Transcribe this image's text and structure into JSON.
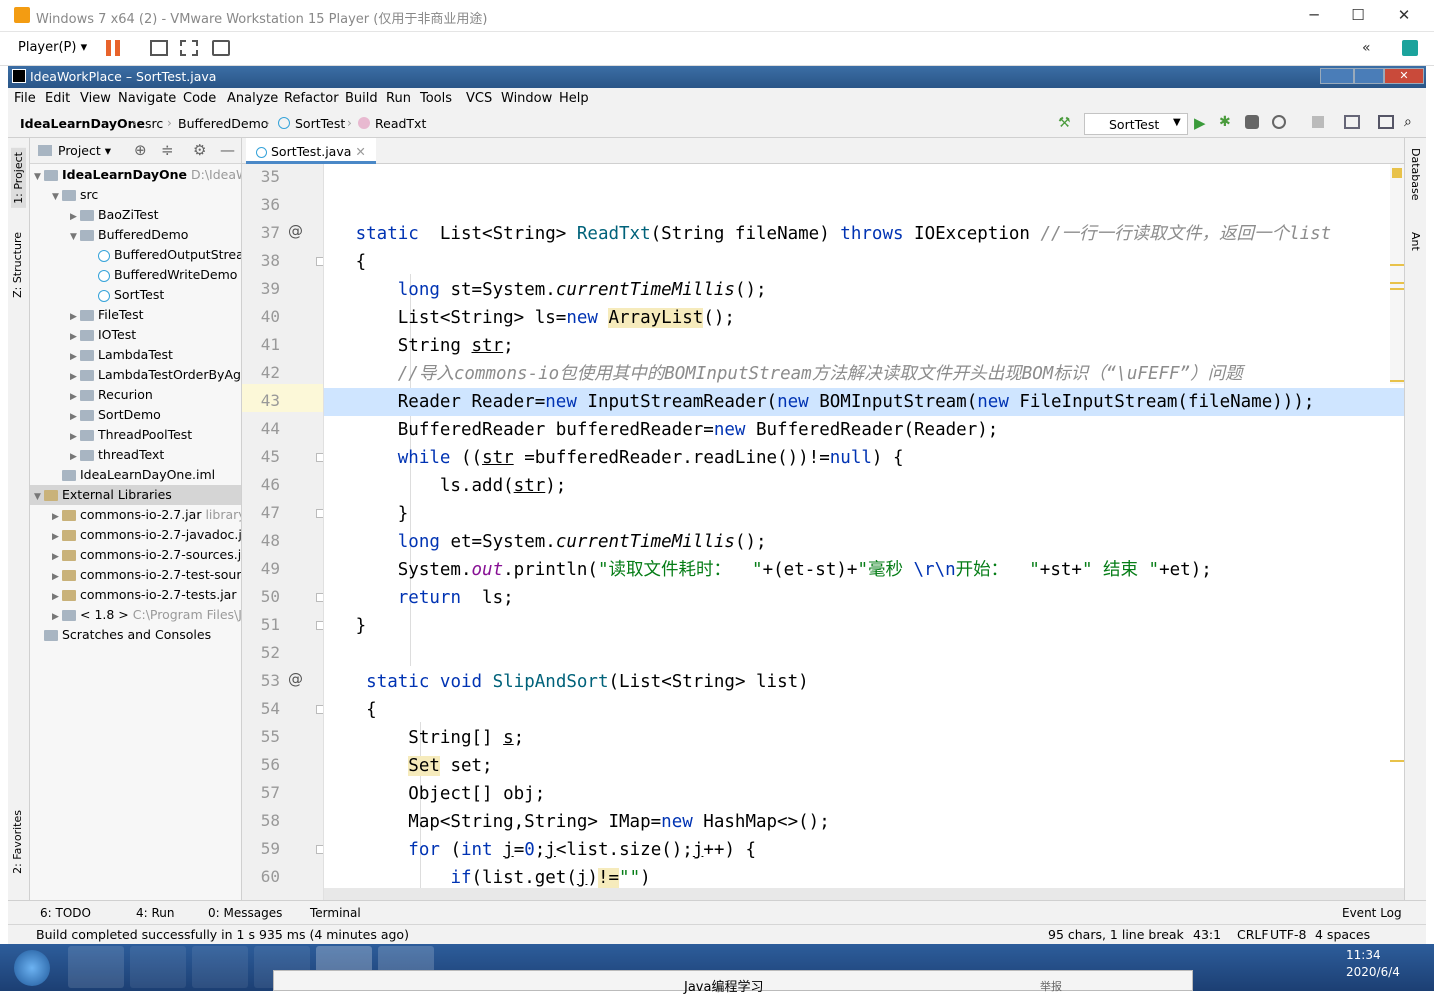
{
  "vmware": {
    "title": "Windows 7 x64 (2) - VMware Workstation 15 Player (仅用于非商业用途)",
    "player_menu": "Player(P)"
  },
  "ide": {
    "title": "IdeaWorkPlace – SortTest.java",
    "menu": [
      "File",
      "Edit",
      "View",
      "Navigate",
      "Code",
      "Analyze",
      "Refactor",
      "Build",
      "Run",
      "Tools",
      "VCS",
      "Window",
      "Help"
    ],
    "breadcrumb": [
      "IdeaLearnDayOne",
      "src",
      "BufferedDemo",
      "SortTest",
      "ReadTxt"
    ],
    "run_config": "SortTest",
    "left_tabs": [
      "1: Project",
      "Z: Structure",
      "2: Favorites"
    ],
    "right_tabs": [
      "Database",
      "Ant"
    ],
    "project_view": "Project",
    "tree": [
      {
        "label": "IdeaLearnDayOne",
        "extra": "D:\\IdeaW",
        "indent": 0,
        "type": "module",
        "arrow": "▼",
        "bold": true
      },
      {
        "label": "src",
        "extra": "",
        "indent": 1,
        "type": "folder",
        "arrow": "▼"
      },
      {
        "label": "BaoZiTest",
        "extra": "",
        "indent": 2,
        "type": "folder",
        "arrow": "▶"
      },
      {
        "label": "BufferedDemo",
        "extra": "",
        "indent": 2,
        "type": "folder",
        "arrow": "▼"
      },
      {
        "label": "BufferedOutputStrea",
        "extra": "",
        "indent": 3,
        "type": "java",
        "arrow": ""
      },
      {
        "label": "BufferedWriteDemo",
        "extra": "",
        "indent": 3,
        "type": "java",
        "arrow": ""
      },
      {
        "label": "SortTest",
        "extra": "",
        "indent": 3,
        "type": "java",
        "arrow": ""
      },
      {
        "label": "FileTest",
        "extra": "",
        "indent": 2,
        "type": "folder",
        "arrow": "▶"
      },
      {
        "label": "IOTest",
        "extra": "",
        "indent": 2,
        "type": "folder",
        "arrow": "▶"
      },
      {
        "label": "LambdaTest",
        "extra": "",
        "indent": 2,
        "type": "folder",
        "arrow": "▶"
      },
      {
        "label": "LambdaTestOrderByAg",
        "extra": "",
        "indent": 2,
        "type": "folder",
        "arrow": "▶"
      },
      {
        "label": "Recurion",
        "extra": "",
        "indent": 2,
        "type": "folder",
        "arrow": "▶"
      },
      {
        "label": "SortDemo",
        "extra": "",
        "indent": 2,
        "type": "folder",
        "arrow": "▶"
      },
      {
        "label": "ThreadPoolTest",
        "extra": "",
        "indent": 2,
        "type": "folder",
        "arrow": "▶"
      },
      {
        "label": "threadText",
        "extra": "",
        "indent": 2,
        "type": "folder",
        "arrow": "▶"
      },
      {
        "label": "IdeaLearnDayOne.iml",
        "extra": "",
        "indent": 1,
        "type": "file",
        "arrow": ""
      },
      {
        "label": "External Libraries",
        "extra": "",
        "indent": 0,
        "type": "lib",
        "arrow": "▼",
        "selected": true
      },
      {
        "label": "commons-io-2.7.jar",
        "extra": "library",
        "indent": 1,
        "type": "jar",
        "arrow": "▶"
      },
      {
        "label": "commons-io-2.7-javadoc.ja",
        "extra": "",
        "indent": 1,
        "type": "jar",
        "arrow": "▶"
      },
      {
        "label": "commons-io-2.7-sources.ja",
        "extra": "",
        "indent": 1,
        "type": "jar",
        "arrow": "▶"
      },
      {
        "label": "commons-io-2.7-test-sourc",
        "extra": "",
        "indent": 1,
        "type": "jar",
        "arrow": "▶"
      },
      {
        "label": "commons-io-2.7-tests.jar",
        "extra": "l",
        "indent": 1,
        "type": "jar",
        "arrow": "▶"
      },
      {
        "label": "< 1.8 >",
        "extra": "C:\\Program Files\\J",
        "indent": 1,
        "type": "folder",
        "arrow": "▶"
      },
      {
        "label": "Scratches and Consoles",
        "extra": "",
        "indent": 0,
        "type": "scratch",
        "arrow": ""
      }
    ],
    "editor_tab": "SortTest.java",
    "line_numbers": [
      "35",
      "36",
      "37",
      "38",
      "39",
      "40",
      "41",
      "42",
      "43",
      "44",
      "45",
      "46",
      "47",
      "48",
      "49",
      "50",
      "51",
      "52",
      "53",
      "54",
      "55",
      "56",
      "57",
      "58",
      "59",
      "60"
    ],
    "bottom_tabs": [
      "6: TODO",
      "4: Run",
      "0: Messages",
      "Terminal",
      "Event Log"
    ],
    "status": {
      "message": "Build completed successfully in 1 s 935 ms (4 minutes ago)",
      "chars": "95 chars, 1 line break",
      "pos": "43:1",
      "line_sep": "CRLF",
      "encoding": "UTF-8",
      "indent": "4 spaces"
    }
  },
  "taskbar": {
    "time": "11:34",
    "date": "2020/6/4"
  },
  "popup": {
    "title": "Java编程学习",
    "left": "举报"
  }
}
